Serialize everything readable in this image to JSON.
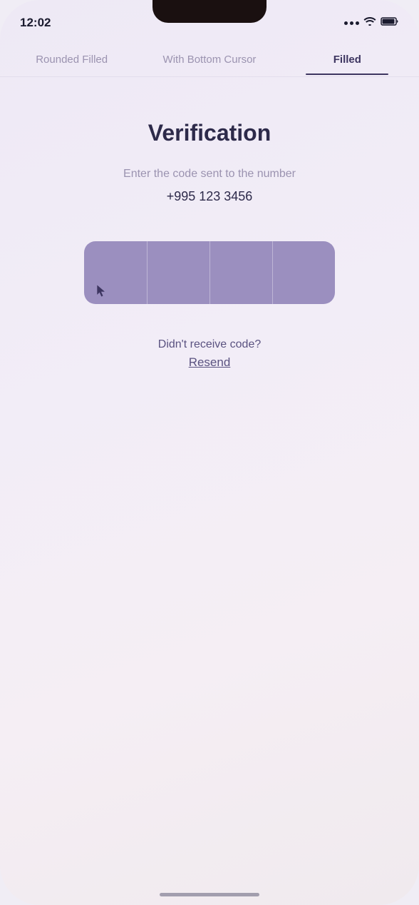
{
  "statusBar": {
    "time": "12:02"
  },
  "tabs": [
    {
      "id": "rounded-filled",
      "label": "Rounded Filled",
      "active": false
    },
    {
      "id": "with-bottom-cursor",
      "label": "With Bottom Cursor",
      "active": false
    },
    {
      "id": "filled",
      "label": "Filled",
      "active": true
    }
  ],
  "page": {
    "title": "Verification",
    "subtitle": "Enter the code sent to the number",
    "phoneNumber": "+995 123 3456"
  },
  "otp": {
    "boxes": [
      "",
      "",
      "",
      ""
    ],
    "placeholders": [
      "",
      "",
      "",
      ""
    ]
  },
  "resend": {
    "question": "Didn't receive code?",
    "linkLabel": "Resend"
  },
  "colors": {
    "accent": "#9b8fbf",
    "activeTab": "#3d3560",
    "titleColor": "#2d2a4a",
    "subtitleColor": "#9b93b0",
    "resendColor": "#5a5280"
  }
}
